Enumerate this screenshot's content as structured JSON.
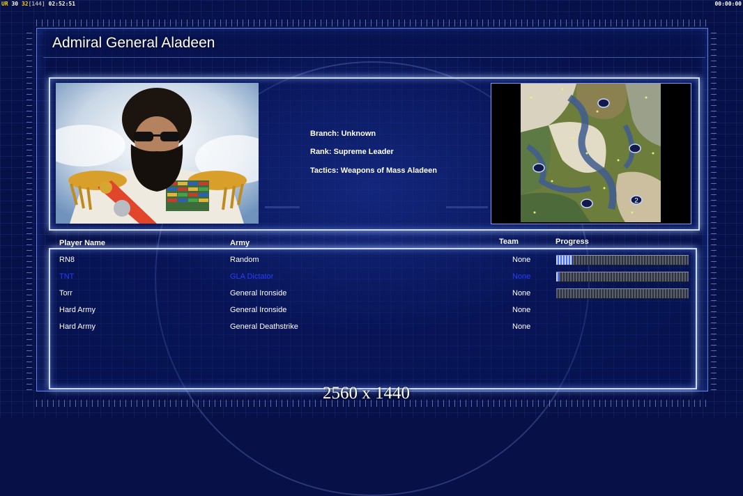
{
  "hud": {
    "left_label": "UR",
    "fps1": "30",
    "fps2": "32",
    "fps3": "[144]",
    "clock": "02:52:51",
    "right_clock": "00:00:00"
  },
  "title": "Admiral General Aladeen",
  "info": {
    "branch": "Branch: Unknown",
    "rank": "Rank: Supreme Leader",
    "tactics": "Tactics: Weapons of Mass Aladeen"
  },
  "table": {
    "headers": {
      "player": "Player Name",
      "army": "Army",
      "team": "Team",
      "progress": "Progress"
    },
    "rows": [
      {
        "player": "RN8",
        "army": "Random",
        "team": "None",
        "progress": 0.12,
        "highlight": false
      },
      {
        "player": "TNT",
        "army": "GLA Dictator",
        "team": "None",
        "progress": 0.02,
        "highlight": true
      },
      {
        "player": "Torr",
        "army": "General Ironside",
        "team": "None",
        "progress": 0.0,
        "highlight": false
      },
      {
        "player": "Hard Army",
        "army": "General Ironside",
        "team": "None",
        "progress": null,
        "highlight": false
      },
      {
        "player": "Hard Army",
        "army": "General Deathstrike",
        "team": "None",
        "progress": null,
        "highlight": false
      }
    ]
  },
  "minimap": {
    "start_label": "2"
  },
  "footer": {
    "resolution": "2560 x 1440"
  },
  "colors": {
    "background": "#071047",
    "panel_border": "#cfdcff",
    "highlight_row": "#2a3cff"
  }
}
